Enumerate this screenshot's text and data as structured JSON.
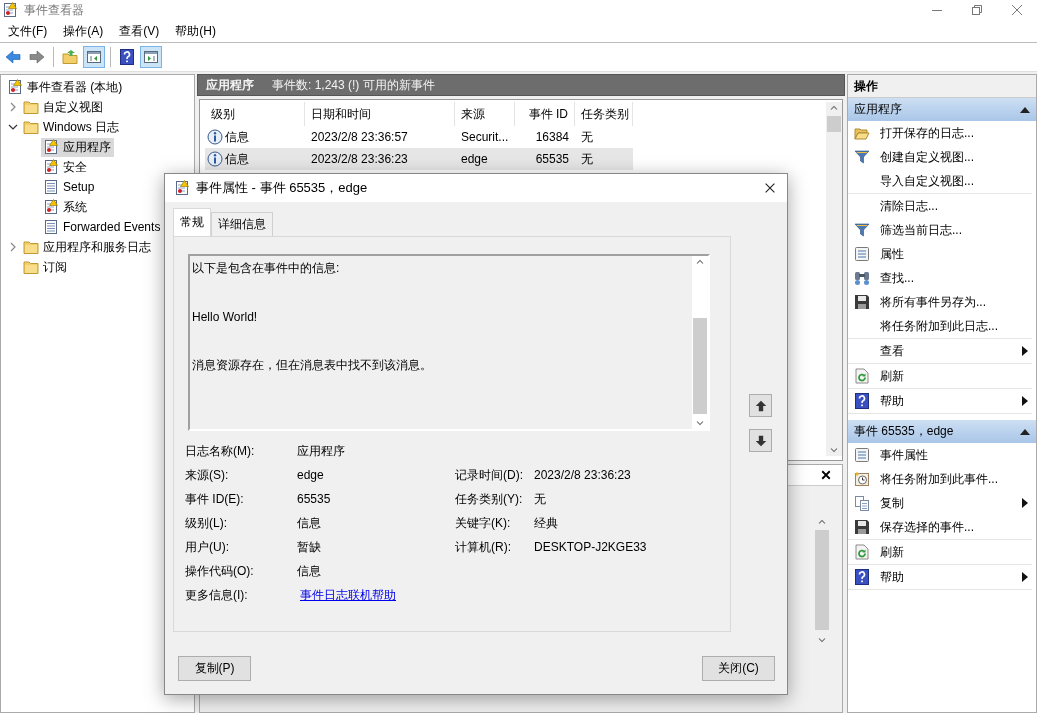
{
  "window": {
    "title": "事件查看器"
  },
  "menu": [
    "文件(F)",
    "操作(A)",
    "查看(V)",
    "帮助(H)"
  ],
  "toolbar": [
    {
      "kind": "back",
      "pressed": false
    },
    {
      "kind": "forward",
      "pressed": false
    },
    {
      "kind": "separator"
    },
    {
      "kind": "folder-up",
      "pressed": false
    },
    {
      "kind": "pane-left",
      "pressed": true
    },
    {
      "kind": "separator"
    },
    {
      "kind": "help",
      "pressed": false
    },
    {
      "kind": "pane-right",
      "pressed": true
    }
  ],
  "tree": [
    {
      "label": "事件查看器 (本地)",
      "kind": "log-warning",
      "selected": false,
      "children": [
        {
          "label": "自定义视图",
          "kind": "folder",
          "selected": false,
          "expanded": false
        },
        {
          "label": "Windows 日志",
          "kind": "folder",
          "selected": false,
          "expanded": true,
          "children": [
            {
              "label": "应用程序",
              "kind": "log-warning",
              "selected": true
            },
            {
              "label": "安全",
              "kind": "log-warning",
              "selected": false
            },
            {
              "label": "Setup",
              "kind": "log",
              "selected": false
            },
            {
              "label": "系统",
              "kind": "log-warning",
              "selected": false
            },
            {
              "label": "Forwarded Events",
              "kind": "log",
              "selected": false
            }
          ]
        },
        {
          "label": "应用程序和服务日志",
          "kind": "folder",
          "selected": false,
          "expanded": false
        },
        {
          "label": "订阅",
          "kind": "folder",
          "selected": false
        }
      ]
    }
  ],
  "center": {
    "title": "应用程序",
    "summary": "事件数: 1,243 (!) 可用的新事件",
    "columns": [
      "级别",
      "日期和时间",
      "来源",
      "事件 ID",
      "任务类别"
    ],
    "rows": [
      {
        "kind": "info",
        "level": "信息",
        "date": "2023/2/8 23:36:57",
        "source": "Securit...",
        "event_id": "16384",
        "category": "无",
        "selected": false
      },
      {
        "kind": "info",
        "level": "信息",
        "date": "2023/2/8 23:36:23",
        "source": "edge",
        "event_id": "65535",
        "category": "无",
        "selected": true
      }
    ]
  },
  "actions": {
    "title": "操作",
    "sections": [
      {
        "title": "应用程序",
        "expanded": true,
        "groups": [
          [
            {
              "label": "打开保存的日志...",
              "kind": "open-folder",
              "submenu": false
            },
            {
              "label": "创建自定义视图...",
              "kind": "funnel",
              "submenu": false
            },
            {
              "label": "导入自定义视图...",
              "kind": "plain",
              "submenu": false
            }
          ],
          [
            {
              "label": "清除日志...",
              "kind": "plain",
              "submenu": false
            },
            {
              "label": "筛选当前日志...",
              "kind": "funnel",
              "submenu": false
            },
            {
              "label": "属性",
              "kind": "properties",
              "submenu": false
            },
            {
              "label": "查找...",
              "kind": "binoculars",
              "submenu": false
            },
            {
              "label": "将所有事件另存为...",
              "kind": "floppy",
              "submenu": false
            },
            {
              "label": "将任务附加到此日志...",
              "kind": "plain",
              "submenu": false
            }
          ],
          [
            {
              "label": "查看",
              "kind": "plain",
              "submenu": true
            }
          ],
          [
            {
              "label": "刷新",
              "kind": "refresh",
              "submenu": false
            }
          ],
          [
            {
              "label": "帮助",
              "kind": "help",
              "submenu": true
            }
          ]
        ]
      },
      {
        "title": "事件 65535，edge",
        "expanded": true,
        "groups": [
          [
            {
              "label": "事件属性",
              "kind": "properties",
              "submenu": false
            },
            {
              "label": "将任务附加到此事件...",
              "kind": "clock",
              "submenu": false
            },
            {
              "label": "复制",
              "kind": "copy",
              "submenu": true
            },
            {
              "label": "保存选择的事件...",
              "kind": "floppy",
              "submenu": false
            }
          ],
          [
            {
              "label": "刷新",
              "kind": "refresh",
              "submenu": false
            }
          ],
          [
            {
              "label": "帮助",
              "kind": "help",
              "submenu": true
            }
          ]
        ]
      }
    ]
  },
  "dialog": {
    "title": "事件属性 - 事件 65535，edge",
    "tabs": [
      {
        "label": "常规",
        "selected": true
      },
      {
        "label": "详细信息",
        "selected": false
      }
    ],
    "message": [
      "以下是包含在事件中的信息:",
      "Hello World!",
      "消息资源存在，但在消息表中找不到该消息。"
    ],
    "rows": [
      {
        "left": {
          "label": "日志名称(M):",
          "value": "应用程序",
          "kind": "text"
        }
      },
      {
        "left": {
          "label": "来源(S):",
          "value": "edge",
          "kind": "text"
        },
        "right": {
          "label": "记录时间(D):",
          "value": "2023/2/8 23:36:23",
          "kind": "text"
        }
      },
      {
        "left": {
          "label": "事件 ID(E):",
          "value": "65535",
          "kind": "text"
        },
        "right": {
          "label": "任务类别(Y):",
          "value": "无",
          "kind": "text"
        }
      },
      {
        "left": {
          "label": "级别(L):",
          "value": "信息",
          "kind": "text"
        },
        "right": {
          "label": "关键字(K):",
          "value": "经典",
          "kind": "text"
        }
      },
      {
        "left": {
          "label": "用户(U):",
          "value": "暂缺",
          "kind": "text"
        },
        "right": {
          "label": "计算机(R):",
          "value": "DESKTOP-J2KGE33",
          "kind": "text"
        }
      },
      {
        "left": {
          "label": "操作代码(O):",
          "value": "信息",
          "kind": "text"
        }
      },
      {
        "left": {
          "label": "更多信息(I):",
          "value": "事件日志联机帮助",
          "kind": "link"
        }
      }
    ],
    "buttons": [
      "复制(P)",
      "关闭(C)"
    ]
  }
}
